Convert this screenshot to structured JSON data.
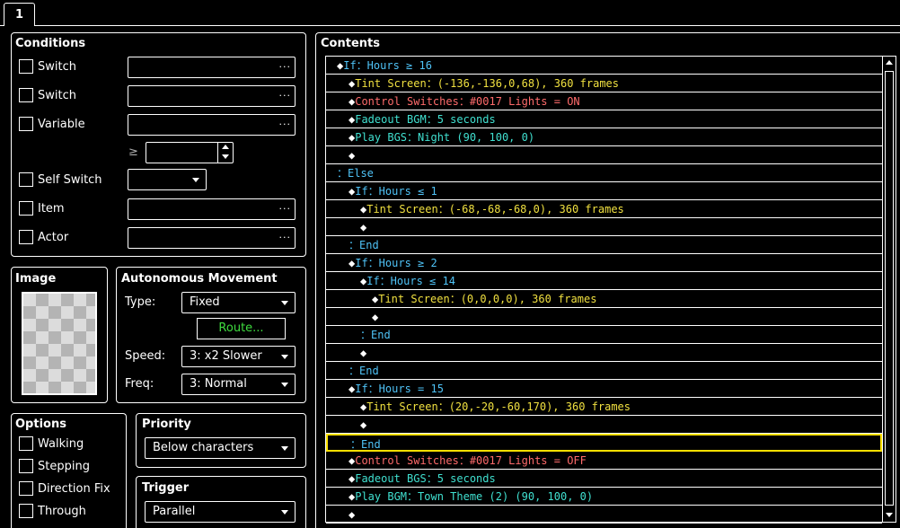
{
  "tab": {
    "label": "1"
  },
  "conditions": {
    "title": "Conditions",
    "items": [
      {
        "label": "Switch",
        "value": "",
        "button": "···"
      },
      {
        "label": "Switch",
        "value": "",
        "button": "···"
      },
      {
        "label": "Variable",
        "value": "",
        "button": "···"
      },
      {
        "label": "Self Switch",
        "value": ""
      },
      {
        "label": "Item",
        "value": "",
        "button": "···"
      },
      {
        "label": "Actor",
        "value": "",
        "button": "···"
      }
    ],
    "ge_symbol": "≥",
    "variable_value": ""
  },
  "image": {
    "title": "Image"
  },
  "autonomous": {
    "title": "Autonomous Movement",
    "type_label": "Type:",
    "type_value": "Fixed",
    "route_button": "Route...",
    "speed_label": "Speed:",
    "speed_value": "3: x2 Slower",
    "freq_label": "Freq:",
    "freq_value": "3: Normal"
  },
  "options": {
    "title": "Options",
    "items": [
      "Walking",
      "Stepping",
      "Direction Fix",
      "Through"
    ]
  },
  "priority": {
    "title": "Priority",
    "value": "Below characters"
  },
  "trigger": {
    "title": "Trigger",
    "value": "Parallel"
  },
  "contents": {
    "title": "Contents",
    "rows": [
      {
        "indent": 0,
        "bullet": "◆",
        "text": "If：Hours ≥ 16",
        "color": "#4fc3f7"
      },
      {
        "indent": 1,
        "bullet": "◆",
        "text": "Tint Screen：(-136,-136,0,68), 360 frames",
        "color": "#f0e040"
      },
      {
        "indent": 1,
        "bullet": "◆",
        "text": "Control Switches：#0017 Lights = ON",
        "color": "#ff6b6b"
      },
      {
        "indent": 1,
        "bullet": "◆",
        "text": "Fadeout BGM：5 seconds",
        "color": "#40e0d0"
      },
      {
        "indent": 1,
        "bullet": "◆",
        "text": "Play BGS：Night (90, 100, 0)",
        "color": "#40e0d0"
      },
      {
        "indent": 1,
        "bullet": "◆",
        "text": "",
        "color": "#ffffff"
      },
      {
        "indent": 0,
        "bullet": "",
        "text": "：Else",
        "color": "#4fc3f7"
      },
      {
        "indent": 1,
        "bullet": "◆",
        "text": "If：Hours ≤ 1",
        "color": "#4fc3f7"
      },
      {
        "indent": 2,
        "bullet": "◆",
        "text": "Tint Screen：(-68,-68,-68,0), 360 frames",
        "color": "#f0e040"
      },
      {
        "indent": 2,
        "bullet": "◆",
        "text": "",
        "color": "#ffffff"
      },
      {
        "indent": 1,
        "bullet": "",
        "text": "：End",
        "color": "#4fc3f7"
      },
      {
        "indent": 1,
        "bullet": "◆",
        "text": "If：Hours ≥ 2",
        "color": "#4fc3f7"
      },
      {
        "indent": 2,
        "bullet": "◆",
        "text": "If：Hours ≤ 14",
        "color": "#4fc3f7"
      },
      {
        "indent": 3,
        "bullet": "◆",
        "text": "Tint Screen：(0,0,0,0), 360 frames",
        "color": "#f0e040"
      },
      {
        "indent": 3,
        "bullet": "◆",
        "text": "",
        "color": "#ffffff"
      },
      {
        "indent": 2,
        "bullet": "",
        "text": "：End",
        "color": "#4fc3f7"
      },
      {
        "indent": 2,
        "bullet": "◆",
        "text": "",
        "color": "#ffffff"
      },
      {
        "indent": 1,
        "bullet": "",
        "text": "：End",
        "color": "#4fc3f7"
      },
      {
        "indent": 1,
        "bullet": "◆",
        "text": "If：Hours = 15",
        "color": "#4fc3f7"
      },
      {
        "indent": 2,
        "bullet": "◆",
        "text": "Tint Screen：(20,-20,-60,170), 360 frames",
        "color": "#f0e040"
      },
      {
        "indent": 2,
        "bullet": "◆",
        "text": "",
        "color": "#ffffff"
      },
      {
        "indent": 1,
        "bullet": "",
        "text": "：End",
        "color": "#4fc3f7",
        "selected": true
      },
      {
        "indent": 1,
        "bullet": "◆",
        "text": "Control Switches：#0017 Lights = OFF",
        "color": "#ff6b6b"
      },
      {
        "indent": 1,
        "bullet": "◆",
        "text": "Fadeout BGS：5 seconds",
        "color": "#40e0d0"
      },
      {
        "indent": 1,
        "bullet": "◆",
        "text": "Play BGM：Town Theme (2) (90, 100, 0)",
        "color": "#40e0d0"
      },
      {
        "indent": 1,
        "bullet": "◆",
        "text": "",
        "color": "#ffffff"
      }
    ]
  }
}
